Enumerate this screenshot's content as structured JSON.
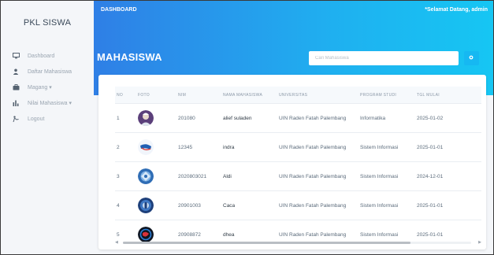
{
  "sidebar": {
    "brand": "PKL SISWA",
    "items": [
      {
        "label": "Dashboard",
        "icon": "monitor-icon"
      },
      {
        "label": "Daftar Mahasiswa",
        "icon": "user-icon"
      },
      {
        "label": "Magang ▾",
        "icon": "briefcase-icon"
      },
      {
        "label": "Nilai Mahasiswa ▾",
        "icon": "bar-chart-icon"
      },
      {
        "label": "Logout",
        "icon": "logout-icon"
      }
    ]
  },
  "topbar": {
    "title": "DASHBOARD",
    "greeting_prefix": "*Selamat Datang, ",
    "greeting_user": "admin"
  },
  "page": {
    "title": "MAHASISWA",
    "search_placeholder": "Cari Mahasiswa",
    "search_button_icon": "search-icon"
  },
  "table": {
    "headers": [
      "NO",
      "FOTO",
      "NIM",
      "NAMA MAHASISWA",
      "UNIVERSITAS",
      "PROGRAM STUDI",
      "TGL MULAI"
    ],
    "rows": [
      {
        "no": "1",
        "nim": "201080",
        "nama": "alief suladen",
        "univ": "UIN Raden Fatah Palembang",
        "prodi": "Informatika",
        "tgl": "2025-01-02",
        "photo": "portrait"
      },
      {
        "no": "2",
        "nim": "12345",
        "nama": "indra",
        "univ": "UIN Raden Fatah Palembang",
        "prodi": "Sistem Informasi",
        "tgl": "2025-01-01",
        "photo": "logo"
      },
      {
        "no": "3",
        "nim": "2020803021",
        "nama": "Aldi",
        "univ": "UIN Raden Fatah Palembang",
        "prodi": "Sistem Informasi",
        "tgl": "2024-12-01",
        "photo": "emblem"
      },
      {
        "no": "4",
        "nim": "20901003",
        "nama": "Caca",
        "univ": "UIN Raden Fatah Palembang",
        "prodi": "Sistem Informasi",
        "tgl": "2025-01-01",
        "photo": "badge"
      },
      {
        "no": "5",
        "nim": "20908872",
        "nama": "dhea",
        "univ": "UIN Raden Fatah Palembang",
        "prodi": "Sistem Informasi",
        "tgl": "2025-01-01",
        "photo": "dark-logo"
      }
    ]
  },
  "colors": {
    "gradient_start": "#2f7fe6",
    "gradient_end": "#16c6f3",
    "accent": "#16b8f2",
    "sidebar_bg": "#f4f6f9"
  }
}
